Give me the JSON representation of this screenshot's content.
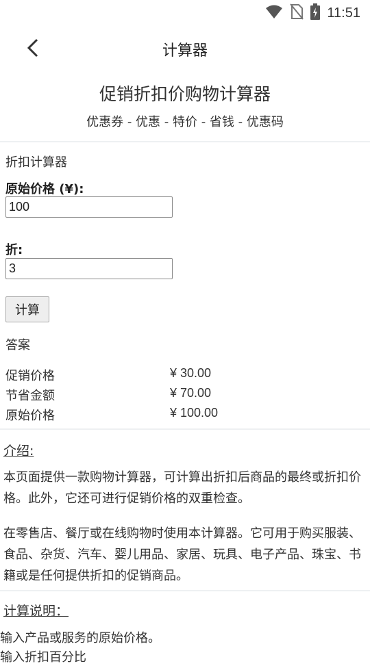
{
  "status_bar": {
    "time": "11:51"
  },
  "app_bar": {
    "title": "计算器"
  },
  "hero": {
    "title": "促销折扣价购物计算器",
    "subtitle": "优惠券 - 优惠 - 特价 - 省钱 - 优惠码"
  },
  "calculator": {
    "heading": "折扣计算器",
    "price_label": "原始价格 (¥):",
    "price_value": "100",
    "discount_label": "折:",
    "discount_value": "3",
    "button_label": "计算",
    "answer_heading": "答案",
    "results": [
      {
        "label": "促销价格",
        "value": "¥ 30.00"
      },
      {
        "label": "节省金额",
        "value": "¥ 70.00"
      },
      {
        "label": "原始价格",
        "value": "¥ 100.00"
      }
    ]
  },
  "intro": {
    "heading": "介绍:",
    "paragraphs": [
      "本页面提供一款购物计算器，可计算出折扣后商品的最终或折扣价格。此外，它还可进行促销价格的双重检查。",
      "在零售店、餐厅或在线购物时使用本计算器。它可用于购买服装、食品、杂货、汽车、婴儿用品、家居、玩具、电子产品、珠宝、书籍或是任何提供折扣的促销商品。"
    ]
  },
  "instructions": {
    "heading": "计算说明：",
    "lines": [
      "输入产品或服务的原始价格。",
      "输入折扣百分比"
    ]
  }
}
